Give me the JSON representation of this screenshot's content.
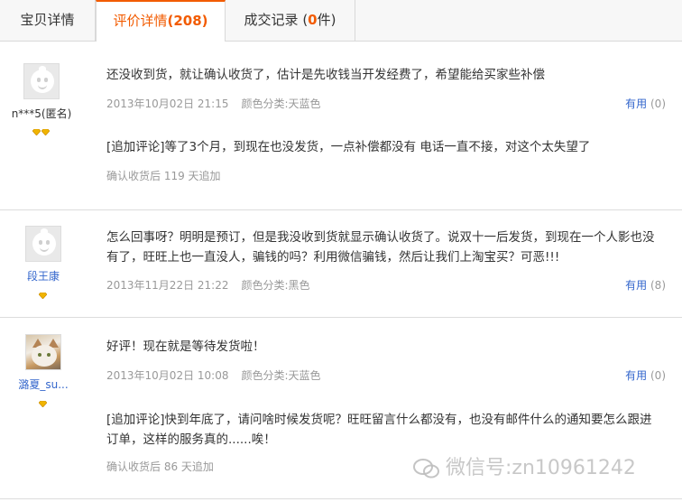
{
  "tabs": {
    "item_details": "宝贝详情",
    "reviews_label": "评价详情",
    "reviews_count": "(208)",
    "deals_label": "成交记录",
    "deals_open": " (",
    "deals_count": "0",
    "deals_close": "件)"
  },
  "reviews": [
    {
      "user": "n***5(匿名)",
      "text": "还没收到货，就让确认收货了，估计是先收钱当开发经费了，希望能给买家些补偿",
      "date": "2013年10月02日 21:15",
      "color": "颜色分类:天蓝色",
      "useful_label": "有用",
      "useful_count": "(0)",
      "append_text": "[追加评论]等了3个月，到现在也没发货，一点补偿都没有 电话一直不接，对这个太失望了",
      "append_meta": "确认收货后 119 天追加"
    },
    {
      "user": "段王康",
      "text_line1": "怎么回事呀？明明是预订，但是我没收到货就显示确认收货了。说双十一后发货，到现在一个人影也没",
      "text_line2": "有了，旺旺上也一直没人，骗钱的吗？利用微信骗钱，然后让我们上淘宝买？可恶!!!",
      "date": "2013年11月22日 21:22",
      "color": "颜色分类:黑色",
      "useful_label": "有用",
      "useful_count": "(8)"
    },
    {
      "user": "潞夏_su...",
      "text": "好评！现在就是等待发货啦！",
      "date": "2013年10月02日 10:08",
      "color": "颜色分类:天蓝色",
      "useful_label": "有用",
      "useful_count": "(0)",
      "append_line1": "[追加评论]快到年底了，请问啥时候发货呢？旺旺留言什么都没有，也没有邮件什么的通知要怎么跟进",
      "append_line2": "订单，这样的服务真的......唉！",
      "append_meta": "确认收货后 86 天追加"
    }
  ],
  "watermark": "微信号:zn10961242",
  "colors": {
    "accent": "#f25b00",
    "link": "#3366cc",
    "muted": "#999999",
    "diamond": "#f0b400"
  }
}
